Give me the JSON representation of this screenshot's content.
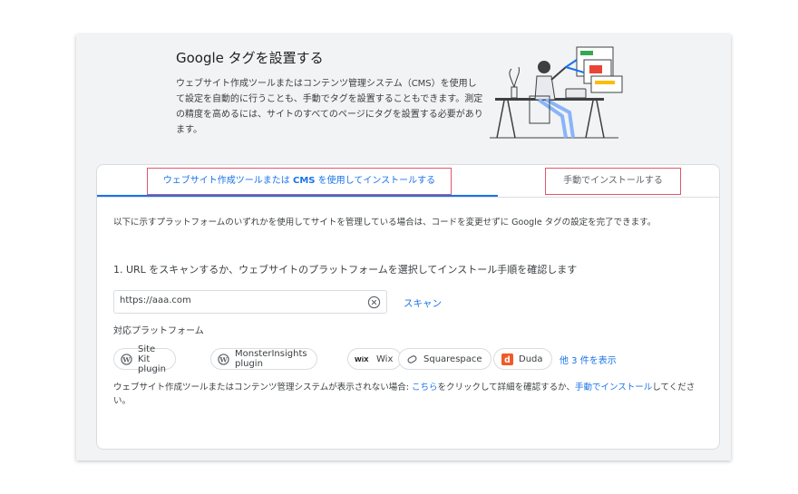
{
  "header": {
    "title": "Google タグを設置する",
    "description": "ウェブサイト作成ツールまたはコンテンツ管理システム（CMS）を使用して設定を自動的に行うことも、手動でタグを設置することもできます。測定の精度を高めるには、サイトのすべてのページにタグを設置する必要があります。"
  },
  "tabs": {
    "cms_pre": "ウェブサイト作成ツールまたは ",
    "cms_hl": "CMS",
    "cms_post": " を使用してインストールする",
    "manual": "手動でインストールする"
  },
  "intro": "以下に示すプラットフォームのいずれかを使用してサイトを管理している場合は、コードを変更せずに Google タグの設定を完了できます。",
  "step1": "1. URL をスキャンするか、ウェブサイトのプラットフォームを選択してインストール手順を確認します",
  "url_input": {
    "value": "https://aaa.com"
  },
  "scan_label": "スキャン",
  "platforms_label": "対応プラットフォーム",
  "platforms": [
    {
      "label": "Site Kit plugin",
      "icon": "wordpress-icon"
    },
    {
      "label": "MonsterInsights plugin",
      "icon": "wordpress-icon"
    },
    {
      "label": "Wix",
      "icon": "wix-icon"
    },
    {
      "label": "Squarespace",
      "icon": "squarespace-icon"
    },
    {
      "label": "Duda",
      "icon": "duda-icon"
    }
  ],
  "more_label": "他 3 件を表示",
  "footer": {
    "pre": "ウェブサイト作成ツールまたはコンテンツ管理システムが表示されない場合: ",
    "link1": "こちら",
    "mid": "をクリックして詳細を確認するか、",
    "link2": "手動でインストール",
    "post": "してください。"
  },
  "colors": {
    "accent": "#1a73e8",
    "highlight_border": "#e0566e",
    "duda": "#f05a28"
  }
}
